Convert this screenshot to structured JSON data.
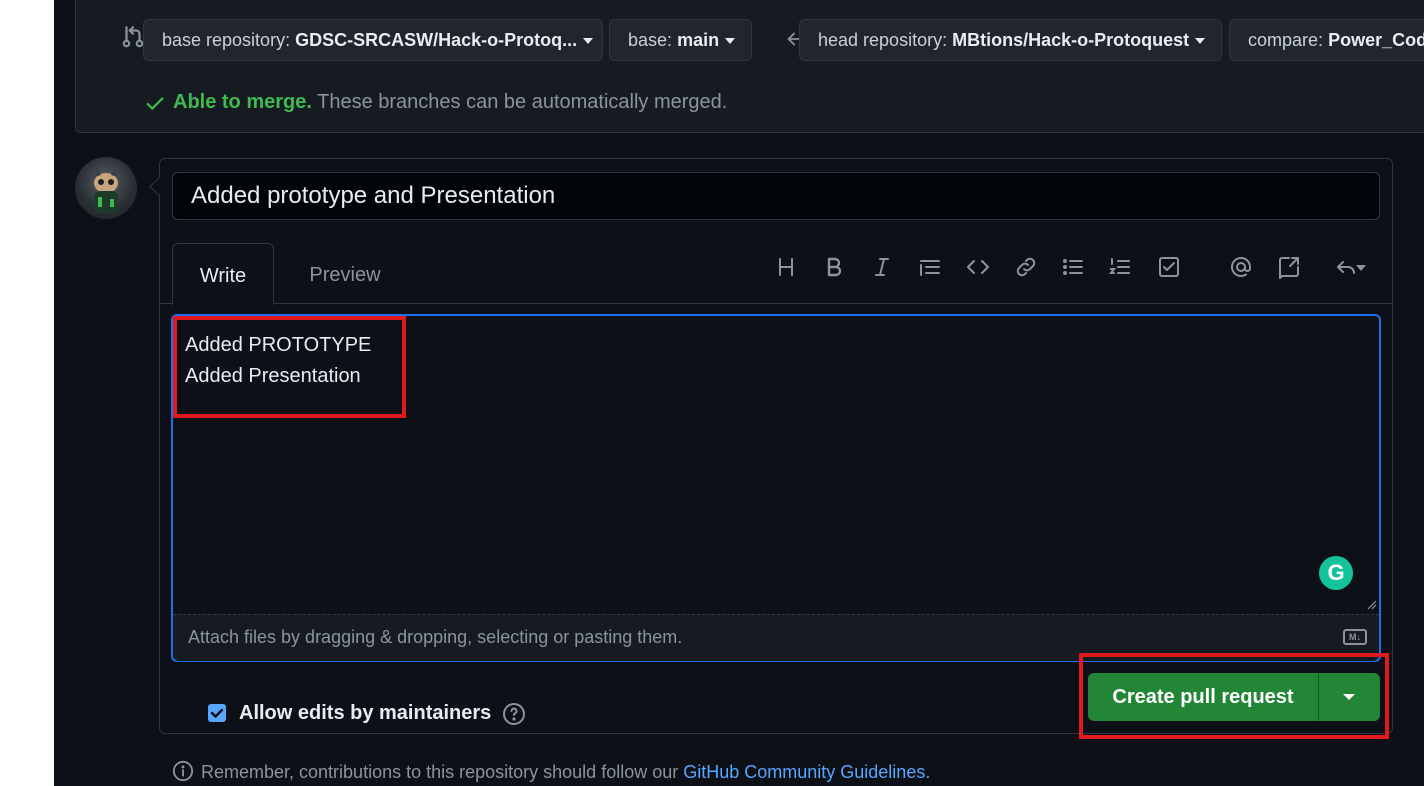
{
  "compare": {
    "base_repository_label": "base repository:",
    "base_repository_value": "GDSC-SRCASW/Hack-o-Protoq...",
    "base_label": "base:",
    "base_value": "main",
    "head_repository_label": "head repository:",
    "head_repository_value": "MBtions/Hack-o-Protoquest",
    "compare_label": "compare:",
    "compare_value": "Power_Codl",
    "merge_status_ok": "Able to merge.",
    "merge_status_desc": "These branches can be automatically merged."
  },
  "pr": {
    "title": "Added prototype and Presentation",
    "tabs": [
      {
        "label": "Write"
      },
      {
        "label": "Preview"
      }
    ],
    "body": "Added PROTOTYPE\nAdded Presentation",
    "attach_hint": "Attach files by dragging & dropping, selecting or pasting them.",
    "markdown_badge": "M↓",
    "grammarly_letter": "G",
    "toolbar_icons": [
      "heading-icon",
      "bold-icon",
      "italic-icon",
      "quote-icon",
      "code-icon",
      "link-icon",
      "unordered-list-icon",
      "ordered-list-icon",
      "task-list-icon",
      "mention-icon",
      "cross-reference-icon",
      "reply-icon"
    ]
  },
  "footer": {
    "allow_edits_label": "Allow edits by maintainers",
    "allow_edits_checked": true,
    "create_button_label": "Create pull request",
    "notice_prefix": "Remember, contributions to this repository should follow our ",
    "notice_link": "GitHub Community Guidelines",
    "notice_suffix": "."
  },
  "colors": {
    "background": "#0d1117",
    "accent_blue": "#1f6feb",
    "success_green": "#238636",
    "merge_green": "#3fb950",
    "highlight_red": "#e0191f"
  }
}
